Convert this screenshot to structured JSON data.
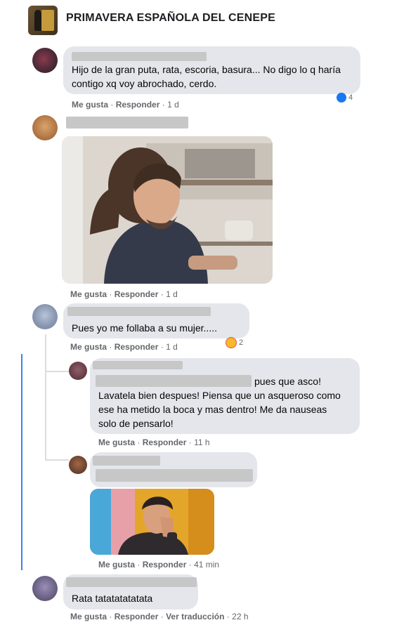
{
  "group": {
    "name": "PRIMAVERA ESPAÑOLA DEL CENEPE"
  },
  "actions": {
    "like": "Me gusta",
    "reply": "Responder",
    "translate": "Ver traducción",
    "dot": "·"
  },
  "comments": [
    {
      "text": "Hijo de la gran puta, rata, escoria, basura... No digo lo q haría contigo xq voy abrochado, cerdo.",
      "time": "1 d",
      "reaction": {
        "icon": "like-icon",
        "count": "4",
        "color": "#1877f2"
      }
    },
    {
      "text": "",
      "time": "1 d",
      "media": "gif-man-with-ponytail"
    },
    {
      "text": "Pues yo me follaba a su mujer.....",
      "time": "1 d",
      "reaction": {
        "icon": "haha-icon",
        "count": "2",
        "color": "#f7b928"
      }
    }
  ],
  "replies": [
    {
      "text_inline": "pues que asco!",
      "text": "Lavatela bien despues! Piensa que un asqueroso como ese ha metido la boca y mas dentro! Me da nauseas solo de pensarlo!",
      "time": "11 h"
    },
    {
      "text": "",
      "time": "41 min",
      "media": "gif-man-hand-on-face"
    }
  ],
  "last_comment": {
    "text": "Rata tatatatatatata",
    "time": "22 h"
  }
}
